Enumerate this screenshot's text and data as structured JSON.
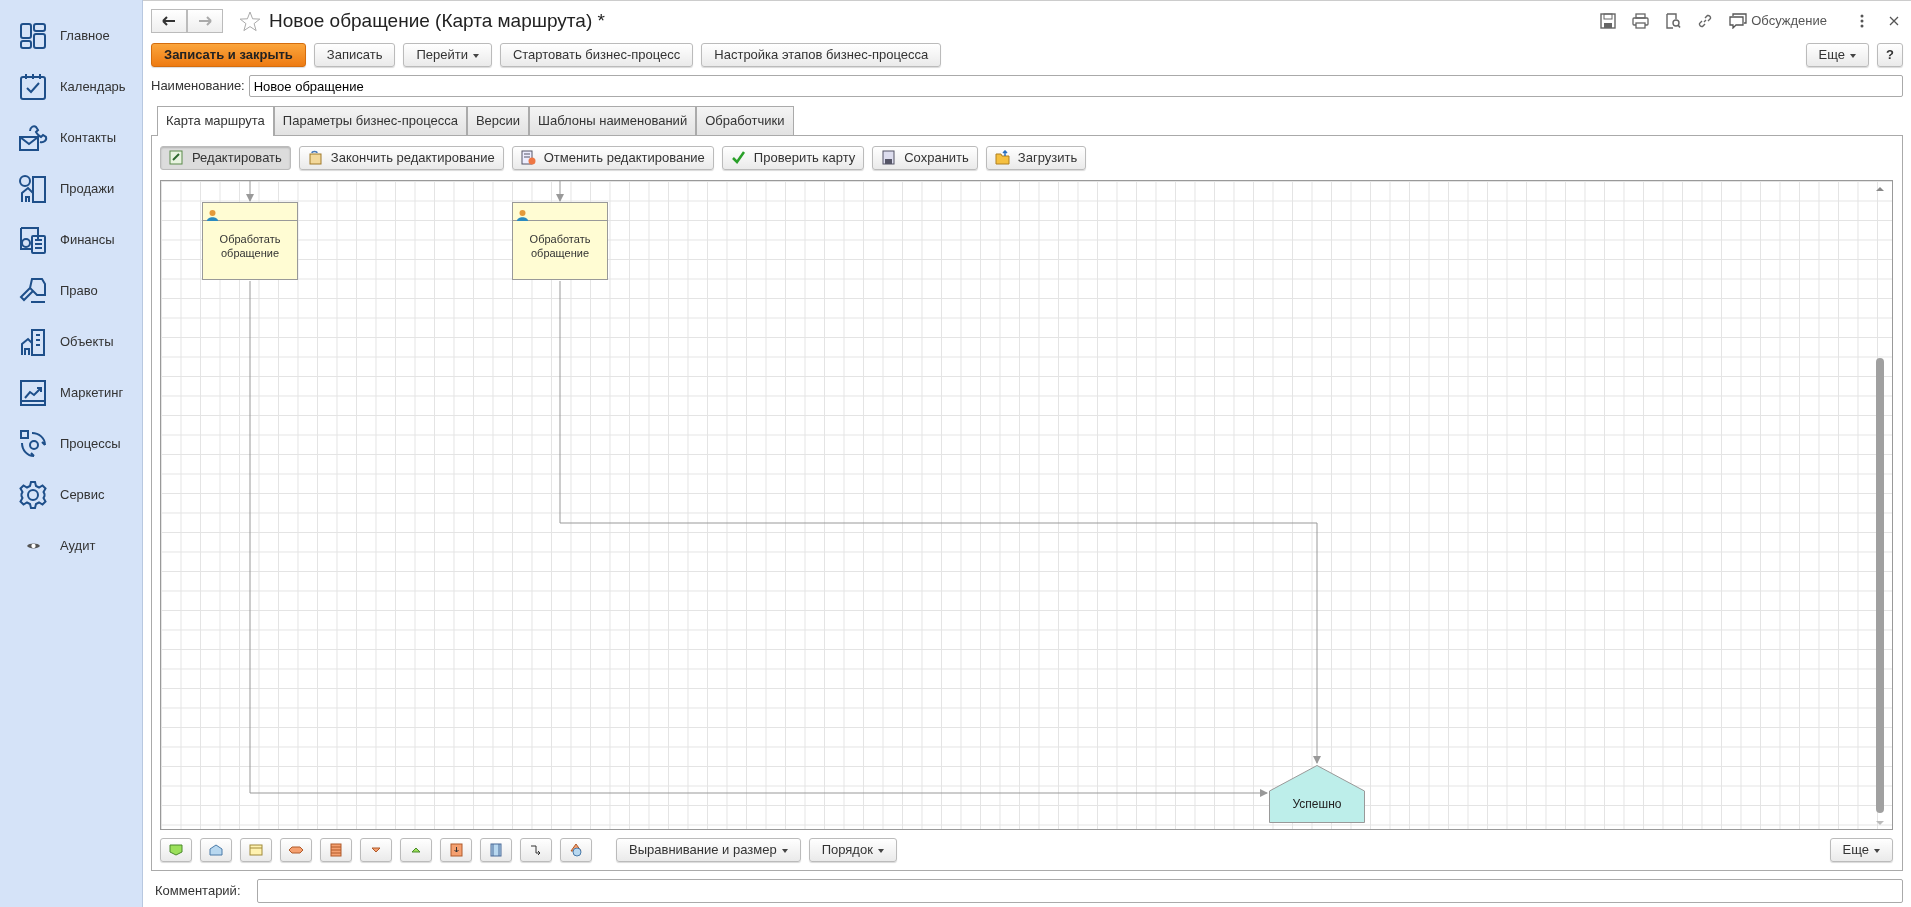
{
  "sidebar": {
    "items": [
      {
        "label": "Главное"
      },
      {
        "label": "Календарь"
      },
      {
        "label": "Контакты"
      },
      {
        "label": "Продажи"
      },
      {
        "label": "Финансы"
      },
      {
        "label": "Право"
      },
      {
        "label": "Объекты"
      },
      {
        "label": "Маркетинг"
      },
      {
        "label": "Процессы"
      },
      {
        "label": "Сервис"
      },
      {
        "label": "Аудит"
      }
    ]
  },
  "header": {
    "title": "Новое обращение (Карта маршрута) *",
    "discussion": "Обсуждение"
  },
  "toolbar": {
    "buttons": [
      {
        "label": "Записать и закрыть",
        "kind": "primary"
      },
      {
        "label": "Записать",
        "kind": "plain"
      },
      {
        "label": "Перейти",
        "kind": "dropdown"
      },
      {
        "label": "Стартовать бизнес-процесс",
        "kind": "plain"
      },
      {
        "label": "Настройка этапов бизнес-процесса",
        "kind": "plain"
      }
    ],
    "more": "Еще",
    "help": "?"
  },
  "name_field": {
    "label": "Наименование:",
    "value": "Новое обращение"
  },
  "tabs": [
    {
      "label": "Карта маршрута",
      "selected": true
    },
    {
      "label": "Параметры бизнес-процесса",
      "selected": false
    },
    {
      "label": "Версии",
      "selected": false
    },
    {
      "label": "Шаблоны наименований",
      "selected": false
    },
    {
      "label": "Обработчики",
      "selected": false
    }
  ],
  "map_toolbar": {
    "buttons": [
      {
        "label": "Редактировать",
        "pressed": true
      },
      {
        "label": "Закончить редактирование",
        "pressed": false
      },
      {
        "label": "Отменить редактирование",
        "pressed": false
      },
      {
        "label": "Проверить карту",
        "pressed": false
      },
      {
        "label": "Сохранить",
        "pressed": false
      },
      {
        "label": "Загрузить",
        "pressed": false
      }
    ]
  },
  "diagram": {
    "nodes": [
      {
        "kind": "task",
        "text": "Обработать обращение"
      },
      {
        "kind": "task",
        "text": "Обработать обращение"
      },
      {
        "kind": "end",
        "text": "Успешно"
      }
    ]
  },
  "shape_toolbar": {
    "menus": [
      "Выравнивание и размер",
      "Порядок"
    ],
    "more": "Еще"
  },
  "comment": {
    "label": "Комментарий:"
  }
}
